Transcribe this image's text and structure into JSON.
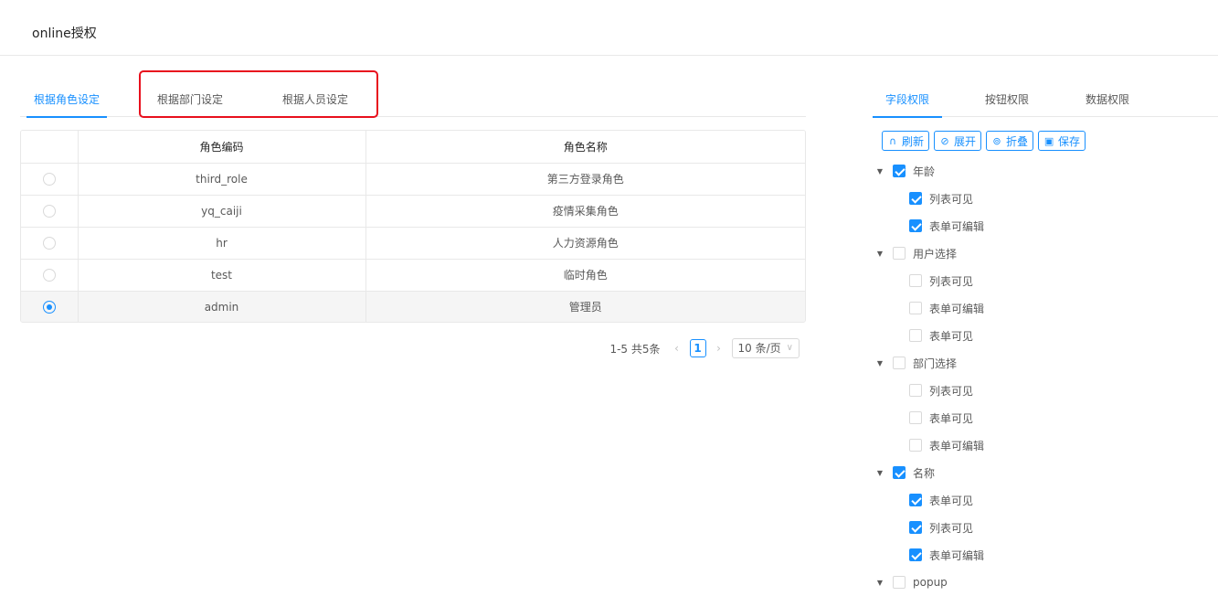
{
  "page_title": "online授权",
  "left_tabs": [
    "根据角色设定",
    "根据部门设定",
    "根据人员设定"
  ],
  "table": {
    "columns": [
      "",
      "角色编码",
      "角色名称"
    ],
    "rows": [
      {
        "code": "third_role",
        "name": "第三方登录角色",
        "selected": false
      },
      {
        "code": "yq_caiji",
        "name": "疫情采集角色",
        "selected": false
      },
      {
        "code": "hr",
        "name": "人力资源角色",
        "selected": false
      },
      {
        "code": "test",
        "name": "临时角色",
        "selected": false
      },
      {
        "code": "admin",
        "name": "管理员",
        "selected": true
      }
    ]
  },
  "pagination": {
    "total": "1-5 共5条",
    "current_page": "1",
    "page_size": "10 条/页"
  },
  "right_tabs": [
    "字段权限",
    "按钮权限",
    "数据权限"
  ],
  "toolbar": {
    "refresh": "刷新",
    "expand": "展开",
    "collapse": "折叠",
    "save": "保存"
  },
  "tree": [
    {
      "label": "年龄",
      "checked": true,
      "children": [
        {
          "label": "列表可见",
          "checked": true
        },
        {
          "label": "表单可编辑",
          "checked": true
        }
      ]
    },
    {
      "label": "用户选择",
      "checked": false,
      "children": [
        {
          "label": "列表可见",
          "checked": false
        },
        {
          "label": "表单可编辑",
          "checked": false
        },
        {
          "label": "表单可见",
          "checked": false
        }
      ]
    },
    {
      "label": "部门选择",
      "checked": false,
      "children": [
        {
          "label": "列表可见",
          "checked": false
        },
        {
          "label": "表单可见",
          "checked": false
        },
        {
          "label": "表单可编辑",
          "checked": false
        }
      ]
    },
    {
      "label": "名称",
      "checked": true,
      "children": [
        {
          "label": "表单可见",
          "checked": true
        },
        {
          "label": "列表可见",
          "checked": true
        },
        {
          "label": "表单可编辑",
          "checked": true
        }
      ]
    },
    {
      "label": "popup",
      "checked": false,
      "children": []
    }
  ],
  "colors": {
    "primary": "#1890ff",
    "highlight_border": "#e8101d"
  }
}
